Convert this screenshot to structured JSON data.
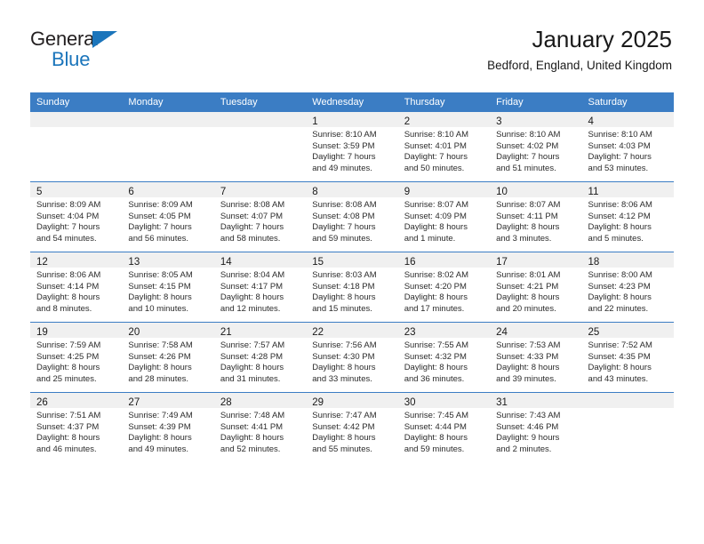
{
  "brand": {
    "name_part1": "General",
    "name_part2": "Blue",
    "accent_color": "#1b75bb"
  },
  "header": {
    "title": "January 2025",
    "subtitle": "Bedford, England, United Kingdom"
  },
  "theme": {
    "header_bg": "#3b7dc4",
    "daynum_band_bg": "#f0f0f0",
    "text_color": "#1a1a1a"
  },
  "weekdays": [
    "Sunday",
    "Monday",
    "Tuesday",
    "Wednesday",
    "Thursday",
    "Friday",
    "Saturday"
  ],
  "labels": {
    "sunrise_prefix": "Sunrise: ",
    "sunset_prefix": "Sunset: ",
    "daylight_prefix": "Daylight: "
  },
  "weeks": [
    [
      {
        "day": "",
        "sunrise": "",
        "sunset": "",
        "daylight_line1": "",
        "daylight_line2": "",
        "empty": true
      },
      {
        "day": "",
        "sunrise": "",
        "sunset": "",
        "daylight_line1": "",
        "daylight_line2": "",
        "empty": true
      },
      {
        "day": "",
        "sunrise": "",
        "sunset": "",
        "daylight_line1": "",
        "daylight_line2": "",
        "empty": true
      },
      {
        "day": "1",
        "sunrise": "Sunrise: 8:10 AM",
        "sunset": "Sunset: 3:59 PM",
        "daylight_line1": "Daylight: 7 hours",
        "daylight_line2": "and 49 minutes.",
        "empty": false
      },
      {
        "day": "2",
        "sunrise": "Sunrise: 8:10 AM",
        "sunset": "Sunset: 4:01 PM",
        "daylight_line1": "Daylight: 7 hours",
        "daylight_line2": "and 50 minutes.",
        "empty": false
      },
      {
        "day": "3",
        "sunrise": "Sunrise: 8:10 AM",
        "sunset": "Sunset: 4:02 PM",
        "daylight_line1": "Daylight: 7 hours",
        "daylight_line2": "and 51 minutes.",
        "empty": false
      },
      {
        "day": "4",
        "sunrise": "Sunrise: 8:10 AM",
        "sunset": "Sunset: 4:03 PM",
        "daylight_line1": "Daylight: 7 hours",
        "daylight_line2": "and 53 minutes.",
        "empty": false
      }
    ],
    [
      {
        "day": "5",
        "sunrise": "Sunrise: 8:09 AM",
        "sunset": "Sunset: 4:04 PM",
        "daylight_line1": "Daylight: 7 hours",
        "daylight_line2": "and 54 minutes.",
        "empty": false
      },
      {
        "day": "6",
        "sunrise": "Sunrise: 8:09 AM",
        "sunset": "Sunset: 4:05 PM",
        "daylight_line1": "Daylight: 7 hours",
        "daylight_line2": "and 56 minutes.",
        "empty": false
      },
      {
        "day": "7",
        "sunrise": "Sunrise: 8:08 AM",
        "sunset": "Sunset: 4:07 PM",
        "daylight_line1": "Daylight: 7 hours",
        "daylight_line2": "and 58 minutes.",
        "empty": false
      },
      {
        "day": "8",
        "sunrise": "Sunrise: 8:08 AM",
        "sunset": "Sunset: 4:08 PM",
        "daylight_line1": "Daylight: 7 hours",
        "daylight_line2": "and 59 minutes.",
        "empty": false
      },
      {
        "day": "9",
        "sunrise": "Sunrise: 8:07 AM",
        "sunset": "Sunset: 4:09 PM",
        "daylight_line1": "Daylight: 8 hours",
        "daylight_line2": "and 1 minute.",
        "empty": false
      },
      {
        "day": "10",
        "sunrise": "Sunrise: 8:07 AM",
        "sunset": "Sunset: 4:11 PM",
        "daylight_line1": "Daylight: 8 hours",
        "daylight_line2": "and 3 minutes.",
        "empty": false
      },
      {
        "day": "11",
        "sunrise": "Sunrise: 8:06 AM",
        "sunset": "Sunset: 4:12 PM",
        "daylight_line1": "Daylight: 8 hours",
        "daylight_line2": "and 5 minutes.",
        "empty": false
      }
    ],
    [
      {
        "day": "12",
        "sunrise": "Sunrise: 8:06 AM",
        "sunset": "Sunset: 4:14 PM",
        "daylight_line1": "Daylight: 8 hours",
        "daylight_line2": "and 8 minutes.",
        "empty": false
      },
      {
        "day": "13",
        "sunrise": "Sunrise: 8:05 AM",
        "sunset": "Sunset: 4:15 PM",
        "daylight_line1": "Daylight: 8 hours",
        "daylight_line2": "and 10 minutes.",
        "empty": false
      },
      {
        "day": "14",
        "sunrise": "Sunrise: 8:04 AM",
        "sunset": "Sunset: 4:17 PM",
        "daylight_line1": "Daylight: 8 hours",
        "daylight_line2": "and 12 minutes.",
        "empty": false
      },
      {
        "day": "15",
        "sunrise": "Sunrise: 8:03 AM",
        "sunset": "Sunset: 4:18 PM",
        "daylight_line1": "Daylight: 8 hours",
        "daylight_line2": "and 15 minutes.",
        "empty": false
      },
      {
        "day": "16",
        "sunrise": "Sunrise: 8:02 AM",
        "sunset": "Sunset: 4:20 PM",
        "daylight_line1": "Daylight: 8 hours",
        "daylight_line2": "and 17 minutes.",
        "empty": false
      },
      {
        "day": "17",
        "sunrise": "Sunrise: 8:01 AM",
        "sunset": "Sunset: 4:21 PM",
        "daylight_line1": "Daylight: 8 hours",
        "daylight_line2": "and 20 minutes.",
        "empty": false
      },
      {
        "day": "18",
        "sunrise": "Sunrise: 8:00 AM",
        "sunset": "Sunset: 4:23 PM",
        "daylight_line1": "Daylight: 8 hours",
        "daylight_line2": "and 22 minutes.",
        "empty": false
      }
    ],
    [
      {
        "day": "19",
        "sunrise": "Sunrise: 7:59 AM",
        "sunset": "Sunset: 4:25 PM",
        "daylight_line1": "Daylight: 8 hours",
        "daylight_line2": "and 25 minutes.",
        "empty": false
      },
      {
        "day": "20",
        "sunrise": "Sunrise: 7:58 AM",
        "sunset": "Sunset: 4:26 PM",
        "daylight_line1": "Daylight: 8 hours",
        "daylight_line2": "and 28 minutes.",
        "empty": false
      },
      {
        "day": "21",
        "sunrise": "Sunrise: 7:57 AM",
        "sunset": "Sunset: 4:28 PM",
        "daylight_line1": "Daylight: 8 hours",
        "daylight_line2": "and 31 minutes.",
        "empty": false
      },
      {
        "day": "22",
        "sunrise": "Sunrise: 7:56 AM",
        "sunset": "Sunset: 4:30 PM",
        "daylight_line1": "Daylight: 8 hours",
        "daylight_line2": "and 33 minutes.",
        "empty": false
      },
      {
        "day": "23",
        "sunrise": "Sunrise: 7:55 AM",
        "sunset": "Sunset: 4:32 PM",
        "daylight_line1": "Daylight: 8 hours",
        "daylight_line2": "and 36 minutes.",
        "empty": false
      },
      {
        "day": "24",
        "sunrise": "Sunrise: 7:53 AM",
        "sunset": "Sunset: 4:33 PM",
        "daylight_line1": "Daylight: 8 hours",
        "daylight_line2": "and 39 minutes.",
        "empty": false
      },
      {
        "day": "25",
        "sunrise": "Sunrise: 7:52 AM",
        "sunset": "Sunset: 4:35 PM",
        "daylight_line1": "Daylight: 8 hours",
        "daylight_line2": "and 43 minutes.",
        "empty": false
      }
    ],
    [
      {
        "day": "26",
        "sunrise": "Sunrise: 7:51 AM",
        "sunset": "Sunset: 4:37 PM",
        "daylight_line1": "Daylight: 8 hours",
        "daylight_line2": "and 46 minutes.",
        "empty": false
      },
      {
        "day": "27",
        "sunrise": "Sunrise: 7:49 AM",
        "sunset": "Sunset: 4:39 PM",
        "daylight_line1": "Daylight: 8 hours",
        "daylight_line2": "and 49 minutes.",
        "empty": false
      },
      {
        "day": "28",
        "sunrise": "Sunrise: 7:48 AM",
        "sunset": "Sunset: 4:41 PM",
        "daylight_line1": "Daylight: 8 hours",
        "daylight_line2": "and 52 minutes.",
        "empty": false
      },
      {
        "day": "29",
        "sunrise": "Sunrise: 7:47 AM",
        "sunset": "Sunset: 4:42 PM",
        "daylight_line1": "Daylight: 8 hours",
        "daylight_line2": "and 55 minutes.",
        "empty": false
      },
      {
        "day": "30",
        "sunrise": "Sunrise: 7:45 AM",
        "sunset": "Sunset: 4:44 PM",
        "daylight_line1": "Daylight: 8 hours",
        "daylight_line2": "and 59 minutes.",
        "empty": false
      },
      {
        "day": "31",
        "sunrise": "Sunrise: 7:43 AM",
        "sunset": "Sunset: 4:46 PM",
        "daylight_line1": "Daylight: 9 hours",
        "daylight_line2": "and 2 minutes.",
        "empty": false
      },
      {
        "day": "",
        "sunrise": "",
        "sunset": "",
        "daylight_line1": "",
        "daylight_line2": "",
        "empty": true
      }
    ]
  ]
}
